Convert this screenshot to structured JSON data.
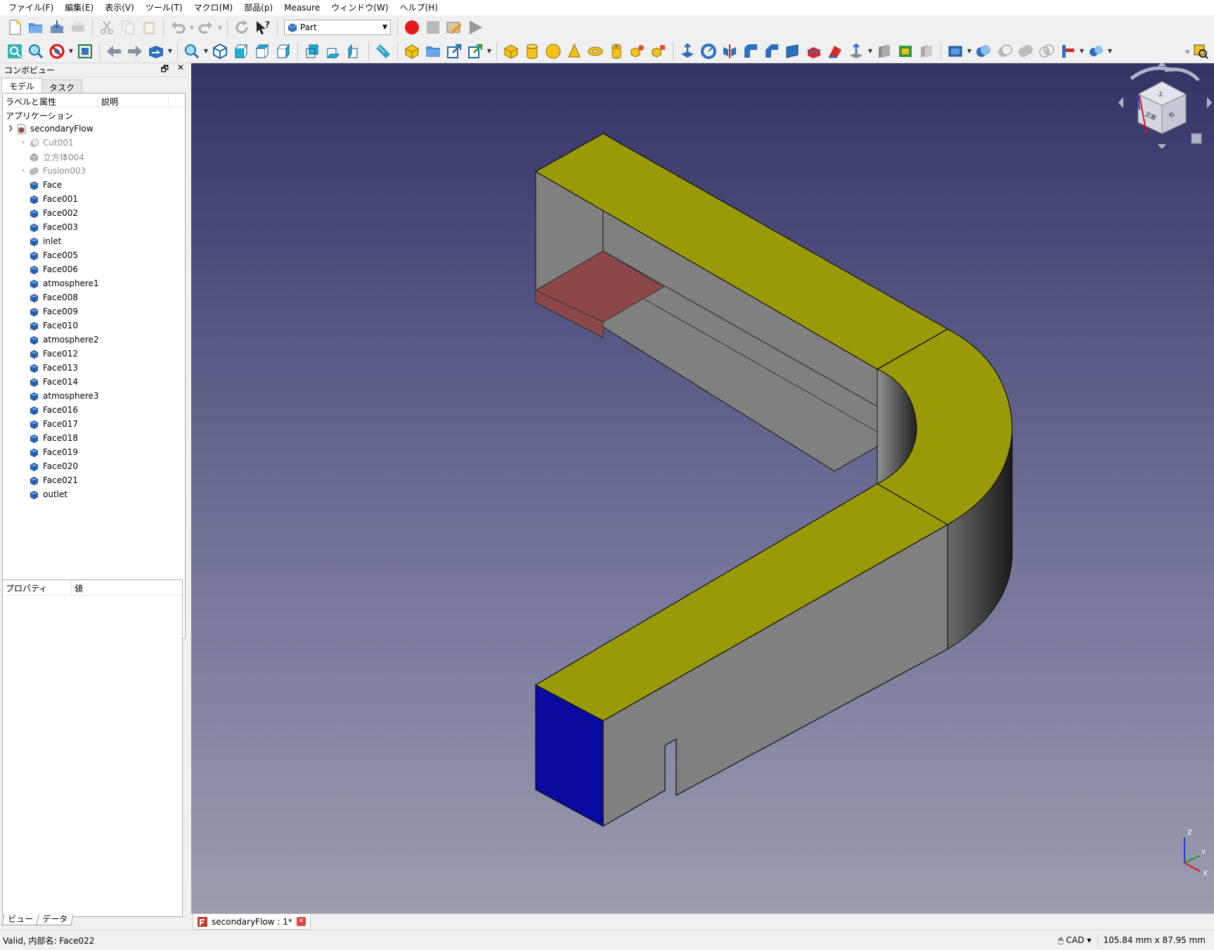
{
  "menu": [
    "ファイル(F)",
    "編集(E)",
    "表示(V)",
    "ツール(T)",
    "マクロ(M)",
    "部品(p)",
    "Measure",
    "ウィンドウ(W)",
    "ヘルプ(H)"
  ],
  "workbench": {
    "selected": "Part",
    "icon": "part-workbench-icon"
  },
  "combo_view": {
    "title": "コンボビュー",
    "tabs": [
      "モデル",
      "タスク"
    ],
    "active_tab": "モデル",
    "tree_header": {
      "label": "ラベルと属性",
      "description": "説明"
    },
    "app_label": "アプリケーション",
    "document": {
      "label": "secondaryFlow",
      "expanded": true
    },
    "items": [
      {
        "label": "Cut001",
        "type": "cut",
        "hidden": true,
        "expandable": true
      },
      {
        "label": "立方体004",
        "type": "box",
        "hidden": true,
        "expandable": false
      },
      {
        "label": "Fusion003",
        "type": "fusion",
        "hidden": true,
        "expandable": true
      },
      {
        "label": "Face",
        "type": "feature",
        "hidden": false
      },
      {
        "label": "Face001",
        "type": "feature",
        "hidden": false
      },
      {
        "label": "Face002",
        "type": "feature",
        "hidden": false
      },
      {
        "label": "Face003",
        "type": "feature",
        "hidden": false
      },
      {
        "label": "inlet",
        "type": "feature",
        "hidden": false
      },
      {
        "label": "Face005",
        "type": "feature",
        "hidden": false
      },
      {
        "label": "Face006",
        "type": "feature",
        "hidden": false
      },
      {
        "label": "atmosphere1",
        "type": "feature",
        "hidden": false
      },
      {
        "label": "Face008",
        "type": "feature",
        "hidden": false
      },
      {
        "label": "Face009",
        "type": "feature",
        "hidden": false
      },
      {
        "label": "Face010",
        "type": "feature",
        "hidden": false
      },
      {
        "label": "atmosphere2",
        "type": "feature",
        "hidden": false
      },
      {
        "label": "Face012",
        "type": "feature",
        "hidden": false
      },
      {
        "label": "Face013",
        "type": "feature",
        "hidden": false
      },
      {
        "label": "Face014",
        "type": "feature",
        "hidden": false
      },
      {
        "label": "atmosphere3",
        "type": "feature",
        "hidden": false
      },
      {
        "label": "Face016",
        "type": "feature",
        "hidden": false
      },
      {
        "label": "Face017",
        "type": "feature",
        "hidden": false
      },
      {
        "label": "Face018",
        "type": "feature",
        "hidden": false
      },
      {
        "label": "Face019",
        "type": "feature",
        "hidden": false
      },
      {
        "label": "Face020",
        "type": "feature",
        "hidden": false
      },
      {
        "label": "Face021",
        "type": "feature",
        "hidden": false
      },
      {
        "label": "outlet",
        "type": "feature",
        "hidden": false
      }
    ],
    "property_header": {
      "property": "プロパティ",
      "value": "値"
    },
    "bottom_tabs": [
      "ビュー",
      "データ"
    ]
  },
  "viewport": {
    "colors": {
      "top_face": "#9a9a08",
      "side_face": "#808080",
      "inlet_face": "#0a0aa0",
      "highlight_face": "#8c4848",
      "bg_top": "#333366",
      "bg_bottom": "#9c9cb0"
    },
    "nav_cube": {
      "faces": [
        "上",
        "正面",
        "右"
      ]
    },
    "axes": [
      "Z",
      "Y",
      "X"
    ]
  },
  "doc_tab": {
    "label": "secondaryFlow : 1*"
  },
  "status": {
    "message": "Valid, 内部名: Face022",
    "nav_style": "CAD",
    "dimensions": "105.84 mm x 87.95 mm"
  }
}
